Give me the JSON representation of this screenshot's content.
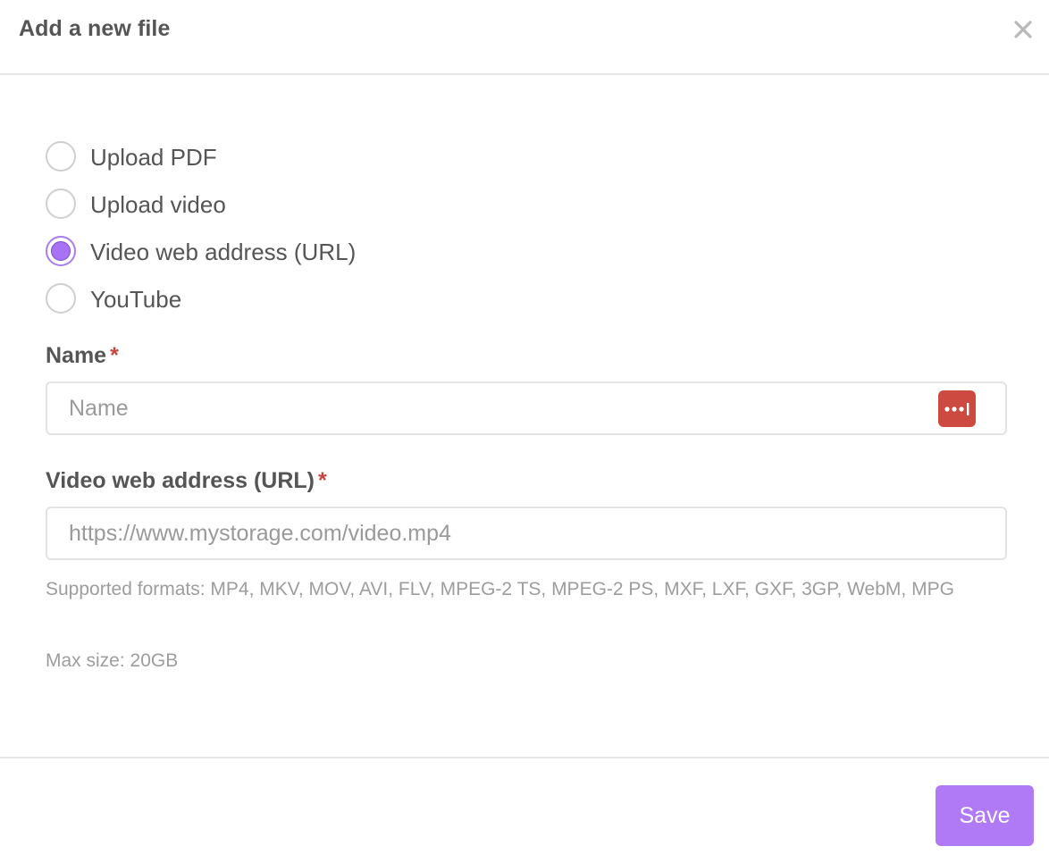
{
  "dialog": {
    "title": "Add a new file",
    "close_icon": "close-icon"
  },
  "file_type": {
    "options": [
      {
        "label": "Upload PDF",
        "checked": false
      },
      {
        "label": "Upload video",
        "checked": false
      },
      {
        "label": "Video web address (URL)",
        "checked": true
      },
      {
        "label": "YouTube",
        "checked": false
      }
    ]
  },
  "name_field": {
    "label": "Name",
    "required_mark": "*",
    "placeholder": "Name",
    "value": "",
    "password_manager_icon": "password-manager-icon"
  },
  "url_field": {
    "label": "Video web address (URL)",
    "required_mark": "*",
    "placeholder": "https://www.mystorage.com/video.mp4",
    "value": ""
  },
  "help": {
    "formats": "Supported formats: MP4, MKV, MOV, AVI, FLV, MPEG-2 TS, MPEG-2 PS, MXF, LXF, GXF, 3GP, WebM, MPG",
    "max_size": "Max size: 20GB"
  },
  "footer": {
    "save_label": "Save"
  },
  "colors": {
    "accent": "#b07af6",
    "radio_checked": "#a872f5",
    "required": "#c9453d",
    "password_manager": "#cc4a3f"
  }
}
